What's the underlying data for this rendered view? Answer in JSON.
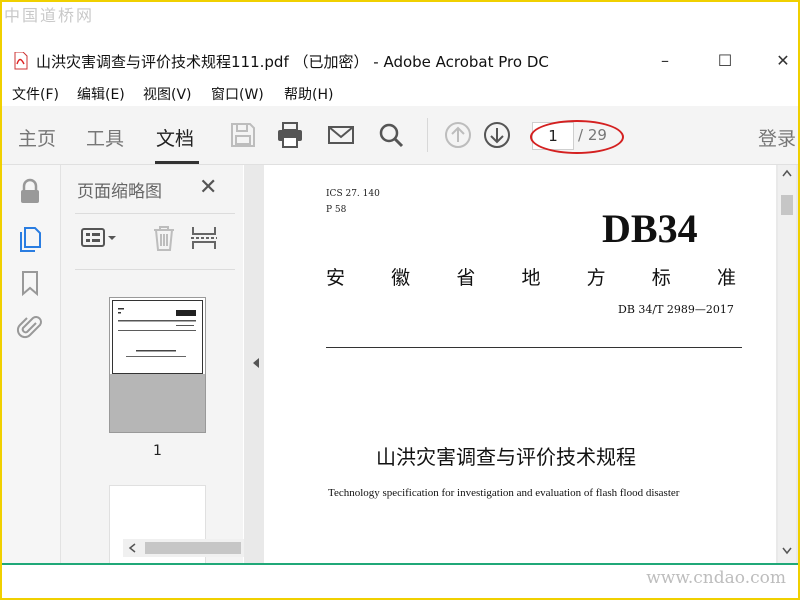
{
  "watermarks": {
    "top": "中国道桥网",
    "bottom": "www.cndao.com"
  },
  "window": {
    "title": "山洪灾害调查与评价技术规程111.pdf （已加密） - Adobe Acrobat Pro DC",
    "minimize": "–",
    "maximize": "☐",
    "close": "✕"
  },
  "menu": {
    "items": [
      {
        "label": "文件(F)"
      },
      {
        "label": "编辑(E)"
      },
      {
        "label": "视图(V)"
      },
      {
        "label": "窗口(W)"
      },
      {
        "label": "帮助(H)"
      }
    ]
  },
  "toolbar": {
    "tabs": [
      {
        "label": "主页"
      },
      {
        "label": "工具"
      },
      {
        "label": "文档"
      }
    ],
    "current_page": "1",
    "total_pages": "/ 29",
    "login": "登录"
  },
  "thumbnails": {
    "title": "页面缩略图",
    "close": "✕",
    "items": [
      {
        "label": "1"
      }
    ]
  },
  "document": {
    "ics": "ICS  27. 140",
    "p": "P  58",
    "db": "DB34",
    "standard_chars": [
      "安",
      "徽",
      "省",
      "地",
      "方",
      "标",
      "准"
    ],
    "std_number": "DB 34/T  2989—2017",
    "title_cn": "山洪灾害调查与评价技术规程",
    "title_en": "Technology specification for investigation and evaluation of flash flood disaster"
  },
  "colors": {
    "frame": "#f0d000",
    "highlight_oval": "#d42020",
    "accent_blue": "#2a7de1",
    "bottom_line": "#20a878"
  }
}
